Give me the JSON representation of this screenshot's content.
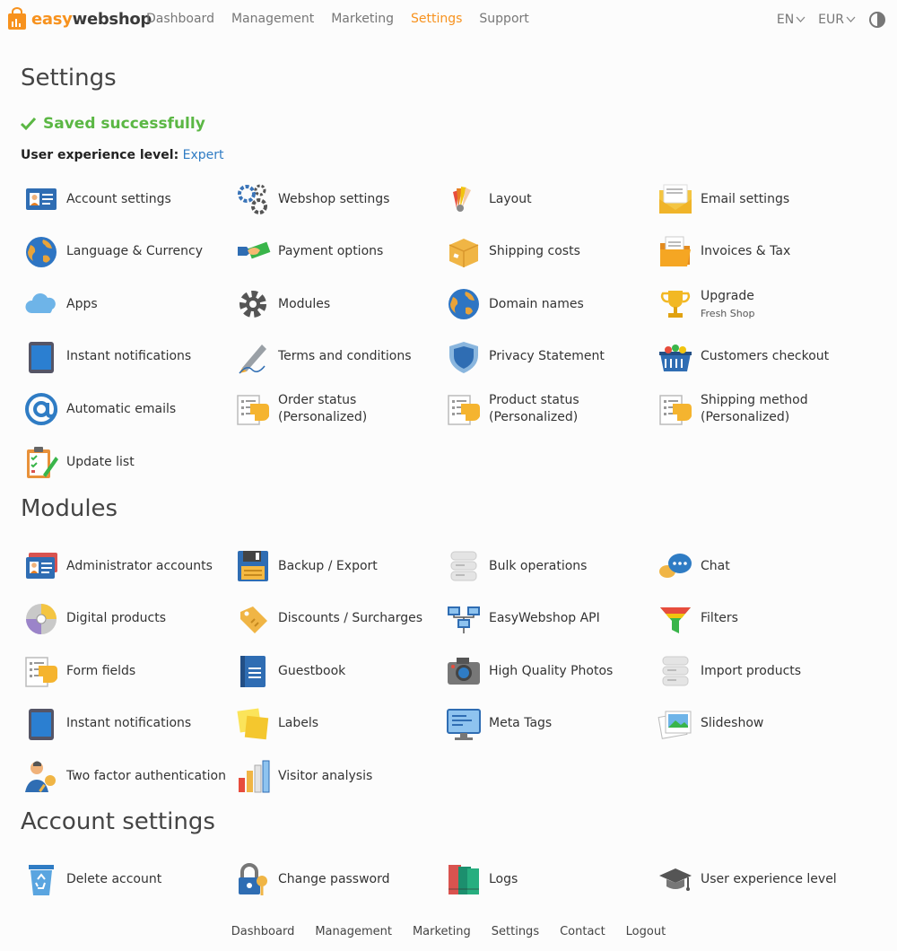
{
  "brand": {
    "logo_part1": "easy",
    "logo_part2": "webshop",
    "accent": "#f7921e"
  },
  "nav": {
    "items": [
      "Dashboard",
      "Management",
      "Marketing",
      "Settings",
      "Support"
    ],
    "active": "Settings"
  },
  "topright": {
    "language": "EN",
    "currency": "EUR"
  },
  "settings": {
    "title": "Settings",
    "saved": "Saved successfully",
    "ux_label": "User experience level:",
    "ux_value": "Expert",
    "items": [
      {
        "label": "Account settings",
        "icon": "id-card-icon"
      },
      {
        "label": "Webshop settings",
        "icon": "gears-icon"
      },
      {
        "label": "Layout",
        "icon": "color-palette-icon"
      },
      {
        "label": "Email settings",
        "icon": "envelope-icon"
      },
      {
        "label": "Language & Currency",
        "icon": "globe-icon"
      },
      {
        "label": "Payment options",
        "icon": "payment-hand-icon"
      },
      {
        "label": "Shipping costs",
        "icon": "box-icon"
      },
      {
        "label": "Invoices & Tax",
        "icon": "folder-icon"
      },
      {
        "label": "Apps",
        "icon": "cloud-icon"
      },
      {
        "label": "Modules",
        "icon": "gear-icon"
      },
      {
        "label": "Domain names",
        "icon": "globe-icon"
      },
      {
        "label": "Upgrade",
        "sub": "Fresh Shop",
        "icon": "trophy-icon"
      },
      {
        "label": "Instant notifications",
        "icon": "tablet-icon"
      },
      {
        "label": "Terms and conditions",
        "icon": "pen-icon"
      },
      {
        "label": "Privacy Statement",
        "icon": "shield-icon"
      },
      {
        "label": "Customers checkout",
        "icon": "basket-icon"
      },
      {
        "label": "Automatic emails",
        "icon": "at-sign-icon"
      },
      {
        "label": "Order status (Personalized)",
        "icon": "checklist-hand-icon"
      },
      {
        "label": "Product status (Personalized)",
        "icon": "checklist-hand-icon"
      },
      {
        "label": "Shipping method (Personalized)",
        "icon": "checklist-hand-icon"
      },
      {
        "label": "Update list",
        "icon": "clipboard-icon"
      }
    ]
  },
  "modules": {
    "title": "Modules",
    "items": [
      {
        "label": "Administrator accounts",
        "icon": "id-cards-icon"
      },
      {
        "label": "Backup / Export",
        "icon": "floppy-disk-icon"
      },
      {
        "label": "Bulk operations",
        "icon": "server-icon"
      },
      {
        "label": "Chat",
        "icon": "chat-bubbles-icon"
      },
      {
        "label": "Digital products",
        "icon": "cd-icon"
      },
      {
        "label": "Discounts / Surcharges",
        "icon": "tag-icon"
      },
      {
        "label": "EasyWebshop API",
        "icon": "network-icon"
      },
      {
        "label": "Filters",
        "icon": "funnel-icon"
      },
      {
        "label": "Form fields",
        "icon": "checklist-hand-icon"
      },
      {
        "label": "Guestbook",
        "icon": "book-icon"
      },
      {
        "label": "High Quality Photos",
        "icon": "camera-icon"
      },
      {
        "label": "Import products",
        "icon": "server-icon"
      },
      {
        "label": "Instant notifications",
        "icon": "tablet-icon"
      },
      {
        "label": "Labels",
        "icon": "sticky-notes-icon"
      },
      {
        "label": "Meta Tags",
        "icon": "monitor-icon"
      },
      {
        "label": "Slideshow",
        "icon": "photos-icon"
      },
      {
        "label": "Two factor authentication",
        "icon": "user-key-icon"
      },
      {
        "label": "Visitor analysis",
        "icon": "bar-chart-icon"
      }
    ]
  },
  "account": {
    "title": "Account settings",
    "items": [
      {
        "label": "Delete account",
        "icon": "recycle-bin-icon"
      },
      {
        "label": "Change password",
        "icon": "padlock-key-icon"
      },
      {
        "label": "Logs",
        "icon": "books-icon"
      },
      {
        "label": "User experience level",
        "icon": "graduation-cap-icon"
      }
    ]
  },
  "footer": [
    "Dashboard",
    "Management",
    "Marketing",
    "Settings",
    "Contact",
    "Logout"
  ]
}
